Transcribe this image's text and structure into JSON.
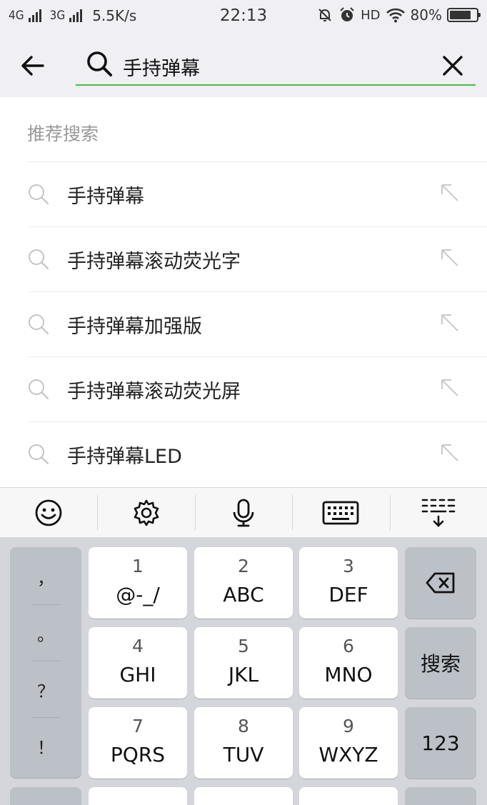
{
  "status_bar": {
    "network_1": "4G",
    "network_2": "3G",
    "speed": "5.5K/s",
    "time": "22:13",
    "hd": "HD",
    "battery": "80%",
    "battery_level": 0.8,
    "icons": [
      "mute-bell-icon",
      "alarm-icon",
      "wifi-icon",
      "battery-icon"
    ]
  },
  "search": {
    "query": "手持弹幕",
    "accent": "#45c046"
  },
  "suggestions": {
    "title": "推荐搜索",
    "items": [
      {
        "label": "手持弹幕"
      },
      {
        "label": "手持弹幕滚动荧光字"
      },
      {
        "label": "手持弹幕加强版"
      },
      {
        "label": "手持弹幕滚动荧光屏"
      },
      {
        "label": "手持弹幕LED"
      }
    ]
  },
  "keyboard_toolbar": {
    "icons": [
      "emoji-icon",
      "gear-icon",
      "microphone-icon",
      "keyboard-icon",
      "hide-keyboard-icon"
    ]
  },
  "keyboard": {
    "punctuation": [
      "，",
      "。",
      "？",
      "！"
    ],
    "keys": [
      {
        "num": "1",
        "letters": "@-_/"
      },
      {
        "num": "2",
        "letters": "ABC"
      },
      {
        "num": "3",
        "letters": "DEF"
      },
      {
        "num": "4",
        "letters": "GHI"
      },
      {
        "num": "5",
        "letters": "JKL"
      },
      {
        "num": "6",
        "letters": "MNO"
      },
      {
        "num": "7",
        "letters": "PQRS"
      },
      {
        "num": "8",
        "letters": "TUV"
      },
      {
        "num": "9",
        "letters": "WXYZ"
      }
    ],
    "search_label": "搜索",
    "numbers_label": "123"
  }
}
